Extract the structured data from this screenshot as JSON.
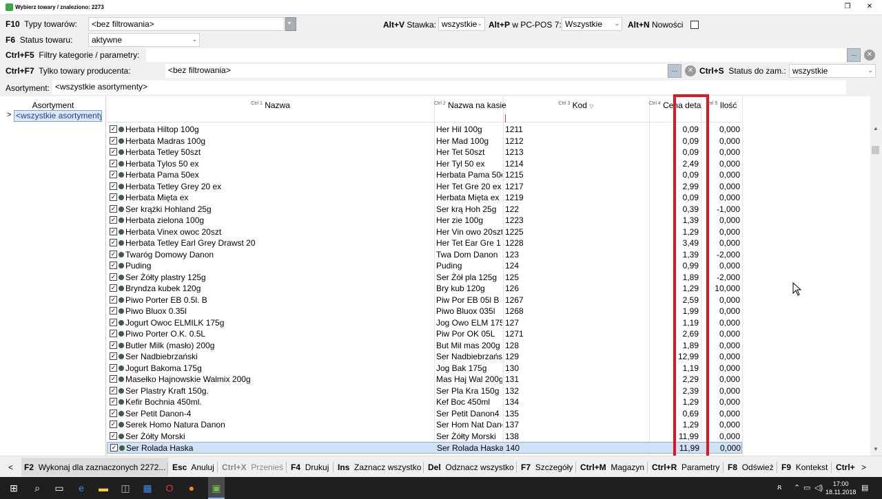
{
  "window": {
    "title": "Wybierz towary / znaleziono: 2273",
    "restore_icon": "restore-icon",
    "close_icon": "close-icon"
  },
  "filters": {
    "f10_key": "F10",
    "f10_label": "Typy towarów:",
    "f10_value": "<bez filtrowania>",
    "f6_key": "F6",
    "f6_label": "Status towaru:",
    "f6_value": "aktywne",
    "altv_key": "Alt+V",
    "altv_label": "Stawka:",
    "altv_value": "wszystkie",
    "altp_key": "Alt+P",
    "altp_label": "w PC-POS 7:",
    "altp_value": "Wszystkie",
    "altn_key": "Alt+N",
    "altn_label": "Nowości",
    "ctrlf5_key": "Ctrl+F5",
    "ctrlf5_label": "Filtry kategorie / parametry:",
    "ctrlf5_value": "",
    "ctrlf7_key": "Ctrl+F7",
    "ctrlf7_label": "Tylko towary producenta:",
    "ctrlf7_value": "<bez filtrowania>",
    "ctrls_key": "Ctrl+S",
    "ctrls_label": "Status do zam.:",
    "ctrls_value": "wszystkie",
    "assortment_label": "Asortyment:",
    "assortment_value": "<wszystkie asortymenty>",
    "dots": "..."
  },
  "left_panel": {
    "header": "Asortyment",
    "item": "<wszystkie asortymenty>",
    "expander": ">"
  },
  "grid": {
    "columns": {
      "name": "Nazwa",
      "name_sort": "Ctrl 1",
      "pos_name": "Nazwa na kasie",
      "pos_name_sort": "Ctrl 2",
      "code": "Kod",
      "code_sort": "Ctrl 3",
      "price": "Cena deta",
      "price_sort": "Ctrl 4",
      "qty": "Ilość",
      "qty_sort": "Ctrl 5"
    },
    "check_mark": "✓",
    "rows": [
      {
        "name": "Herbata Hiltop 100g",
        "pos_name": "Her Hil 100g",
        "code": "1211",
        "price": "0,09",
        "qty": "0,000"
      },
      {
        "name": "Herbata Madras 100g",
        "pos_name": "Her Mad 100g",
        "code": "1212",
        "price": "0,09",
        "qty": "0,000"
      },
      {
        "name": "Herbata Tetley 50szt",
        "pos_name": "Her Tet 50szt",
        "code": "1213",
        "price": "0,09",
        "qty": "0,000"
      },
      {
        "name": "Herbata Tylos 50 ex",
        "pos_name": "Her Tyl 50 ex",
        "code": "1214",
        "price": "2,49",
        "qty": "0,000"
      },
      {
        "name": "Herbata Pama 50ex",
        "pos_name": "Herbata Pama 50e",
        "code": "1215",
        "price": "0,09",
        "qty": "0,000"
      },
      {
        "name": "Herbata Tetley Grey 20 ex",
        "pos_name": "Her Tet Gre 20 ex",
        "code": "1217",
        "price": "2,99",
        "qty": "0,000"
      },
      {
        "name": "Herbata Mięta ex",
        "pos_name": "Herbata Mięta ex",
        "code": "1219",
        "price": "0,09",
        "qty": "0,000"
      },
      {
        "name": "Ser krążki Hohland 25g",
        "pos_name": "Ser krą Hoh 25g",
        "code": "122",
        "price": "0,39",
        "qty": "-1,000"
      },
      {
        "name": "Herbata zielona 100g",
        "pos_name": "Her zie 100g",
        "code": "1223",
        "price": "1,39",
        "qty": "0,000"
      },
      {
        "name": "Herbata Vinex owoc 20szt",
        "pos_name": "Her Vin owo 20szt",
        "code": "1225",
        "price": "1,29",
        "qty": "0,000"
      },
      {
        "name": "Herbata Tetley Earl Grey Drawst 20",
        "pos_name": "Her Tet Ear Gre 1",
        "code": "1228",
        "price": "3,49",
        "qty": "0,000"
      },
      {
        "name": "Twaróg Domowy Danon",
        "pos_name": "Twa Dom Danon",
        "code": "123",
        "price": "1,39",
        "qty": "-2,000"
      },
      {
        "name": "Puding",
        "pos_name": "Puding",
        "code": "124",
        "price": "0,99",
        "qty": "0,000"
      },
      {
        "name": "Ser Żółty plastry 125g",
        "pos_name": "Ser Żół pla 125g",
        "code": "125",
        "price": "1,89",
        "qty": "-2,000"
      },
      {
        "name": "Bryndza kubek 120g",
        "pos_name": "Bry kub 120g",
        "code": "126",
        "price": "1,29",
        "qty": "10,000"
      },
      {
        "name": "Piwo Porter EB 0.5l. B",
        "pos_name": "Piw Por EB 05l B",
        "code": "1267",
        "price": "2,59",
        "qty": "0,000"
      },
      {
        "name": "Piwo Bluox 0.35l",
        "pos_name": "Piwo Bluox 035l",
        "code": "1268",
        "price": "1,99",
        "qty": "0,000"
      },
      {
        "name": "Jogurt Owoc ELMILK 175g",
        "pos_name": "Jog Owo ELM 175",
        "code": "127",
        "price": "1,19",
        "qty": "0,000"
      },
      {
        "name": "Piwo Porter O.K. 0.5L",
        "pos_name": "Piw Por OK 05L",
        "code": "1271",
        "price": "2,69",
        "qty": "0,000"
      },
      {
        "name": "Butler Milk (masło) 200g",
        "pos_name": "But Mil mas 200g",
        "code": "128",
        "price": "1,89",
        "qty": "0,000"
      },
      {
        "name": "Ser Nadbiebrzański",
        "pos_name": "Ser Nadbiebrzańsl",
        "code": "129",
        "price": "12,99",
        "qty": "0,000"
      },
      {
        "name": "Jogurt Bakoma 175g",
        "pos_name": "Jog Bak 175g",
        "code": "130",
        "price": "1,19",
        "qty": "0,000"
      },
      {
        "name": "Masełko Hajnowskie Walmix 200g",
        "pos_name": "Mas Haj Wal 200g",
        "code": "131",
        "price": "2,29",
        "qty": "0,000"
      },
      {
        "name": "Ser Plastry Kraft 150g.",
        "pos_name": "Ser Pla Kra 150g",
        "code": "132",
        "price": "2,39",
        "qty": "0,000"
      },
      {
        "name": "Kefir Bochnia 450ml.",
        "pos_name": "Kef Boc 450ml",
        "code": "134",
        "price": "1,29",
        "qty": "0,000"
      },
      {
        "name": "Ser Petit Danon-4",
        "pos_name": "Ser Petit Danon4",
        "code": "135",
        "price": "0,69",
        "qty": "0,000"
      },
      {
        "name": "Serek Homo Natura Danon",
        "pos_name": "Ser Hom Nat Danc",
        "code": "137",
        "price": "1,29",
        "qty": "0,000"
      },
      {
        "name": "Ser Żółty Morski",
        "pos_name": "Ser Żółty Morski",
        "code": "138",
        "price": "11,99",
        "qty": "0,000"
      },
      {
        "name": "Ser Rolada Haska",
        "pos_name": "Ser Rolada Haska",
        "code": "140",
        "price": "11,99",
        "qty": "0,000"
      }
    ]
  },
  "function_bar": {
    "f2_key": "F2",
    "f2_label": "Wykonaj dla zaznaczonych 2272...",
    "esc_key": "Esc",
    "esc_label": "Anuluj",
    "ctrlx_key": "Ctrl+X",
    "ctrlx_label": "Przenieś",
    "f4_key": "F4",
    "f4_label": "Drukuj",
    "ins_key": "Ins",
    "ins_label": "Zaznacz wszystko",
    "del_key": "Del",
    "del_label": "Odznacz wszystko",
    "f7_key": "F7",
    "f7_label": "Szczegóły",
    "ctrlm_key": "Ctrl+M",
    "ctrlm_label": "Magazyn",
    "ctrlr_key": "Ctrl+R",
    "ctrlr_label": "Parametry",
    "f8_key": "F8",
    "f8_label": "Odśwież",
    "f9_key": "F9",
    "f9_label": "Kontekst",
    "ctrlplus_key": "Ctrl+",
    "prev": "<",
    "next": ">"
  },
  "taskbar": {
    "time": "17:00",
    "date": "18.11.2018"
  },
  "colors": {
    "highlight_box": "#e3161f",
    "selection": "#cfe2f6",
    "app_green": "#3aa845"
  }
}
